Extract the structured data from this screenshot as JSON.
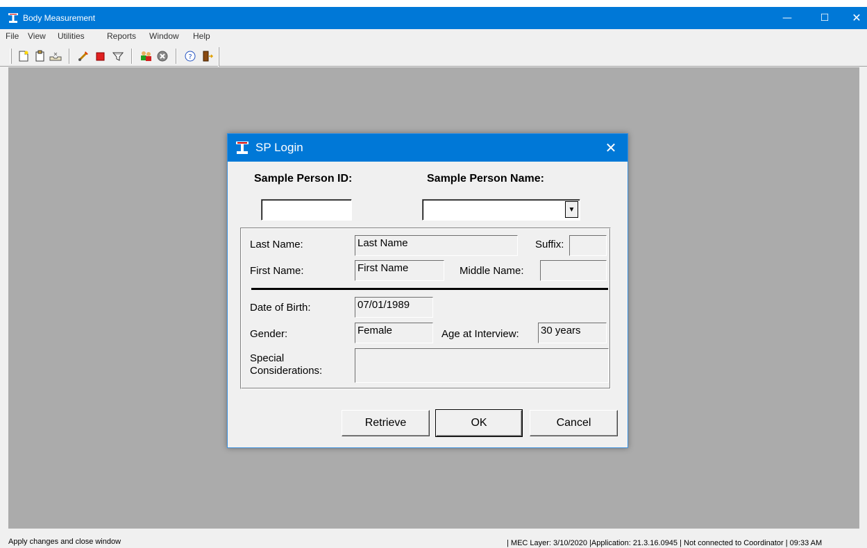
{
  "app": {
    "title": "Body Measurement",
    "window_controls": {
      "minimize": "—",
      "maximize": "☐",
      "close": "✕"
    }
  },
  "menubar": {
    "items": [
      "File",
      "View",
      "Utilities",
      "Reports",
      "Window",
      "Help"
    ]
  },
  "toolbar": {
    "icons": [
      "new-document-icon",
      "clipboard-icon",
      "tray-icon",
      "rocket-icon",
      "stop-icon",
      "filter-icon",
      "people-icon",
      "gear-icon",
      "help-icon",
      "exit-door-icon"
    ]
  },
  "dialog": {
    "title": "SP Login",
    "close_glyph": "✕",
    "sp_id_label": "Sample Person ID:",
    "sp_id_value": "",
    "sp_name_label": "Sample Person Name:",
    "sp_name_value": "",
    "combo_arrow": "▼",
    "fields": {
      "last_name_label": "Last Name:",
      "last_name_value": "Last Name",
      "suffix_label": "Suffix:",
      "suffix_value": "",
      "first_name_label": "First Name:",
      "first_name_value": "First Name",
      "middle_name_label": "Middle Name:",
      "middle_name_value": "",
      "dob_label": "Date of Birth:",
      "dob_value": "07/01/1989",
      "gender_label": "Gender:",
      "gender_value": "Female",
      "age_label": "Age at Interview:",
      "age_value": "30 years",
      "special_label_line1": "Special",
      "special_label_line2": "Considerations:",
      "special_value": ""
    },
    "buttons": {
      "retrieve": "Retrieve",
      "ok": "OK",
      "cancel": "Cancel"
    }
  },
  "statusbar": {
    "left": "Apply changes and close window",
    "right": "| MEC Layer: 3/10/2020  |Application: 21.3.16.0945 |  Not connected to Coordinator  | 09:33 AM"
  },
  "colors": {
    "titlebar": "#0078d7",
    "desktop": "#ababab",
    "chrome": "#f0f0f0"
  }
}
